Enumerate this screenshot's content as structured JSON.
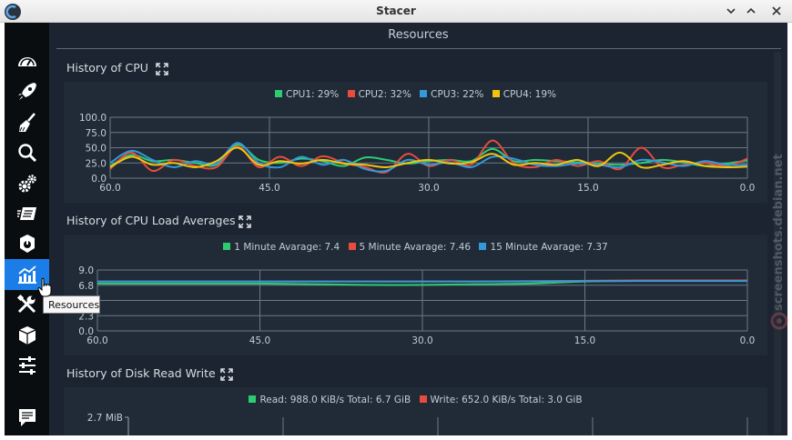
{
  "window": {
    "title": "Stacer"
  },
  "sidebar": {
    "items": [
      {
        "icon": "speedometer-icon",
        "name": "nav-dashboard"
      },
      {
        "icon": "rocket-icon",
        "name": "nav-startup-apps"
      },
      {
        "icon": "broom-icon",
        "name": "nav-system-cleaner"
      },
      {
        "icon": "search-icon",
        "name": "nav-search"
      },
      {
        "icon": "gears-icon",
        "name": "nav-services"
      },
      {
        "icon": "processes-icon",
        "name": "nav-processes"
      },
      {
        "icon": "uninstaller-icon",
        "name": "nav-uninstaller"
      },
      {
        "icon": "chart-icon",
        "name": "nav-resources",
        "active": true
      },
      {
        "icon": "tools-icon",
        "name": "nav-helpers"
      },
      {
        "icon": "package-icon",
        "name": "nav-apt-repository"
      },
      {
        "icon": "sliders-icon",
        "name": "nav-settings"
      },
      {
        "icon": "feedback-icon",
        "name": "nav-feedback"
      }
    ],
    "tooltip": "Resources"
  },
  "page": {
    "title": "Resources"
  },
  "watermark": "screenshots.debian.net",
  "colors": {
    "green": "#2ecc71",
    "red": "#e74c3c",
    "blue": "#3498db",
    "yellow": "#f1c40f",
    "accent": "#1b7ee8"
  },
  "sections": {
    "cpu": {
      "title": "History of CPU",
      "legend": [
        "CPU1: 29%",
        "CPU2: 32%",
        "CPU3: 22%",
        "CPU4: 19%"
      ]
    },
    "load": {
      "title": "History of CPU Load Averages",
      "legend": [
        "1 Minute Avarage: 7.4",
        "5 Minute Avarage: 7.46",
        "15 Minute Avarage: 7.37"
      ]
    },
    "disk": {
      "title": "History of Disk Read Write",
      "legend": [
        "Read: 988.0 KiB/s Total: 6.7 GiB",
        "Write: 652.0 KiB/s Total: 3.0 GiB"
      ]
    }
  },
  "chart_data": [
    {
      "type": "line",
      "title": "History of CPU",
      "x": [
        60,
        58,
        56,
        54,
        52,
        50,
        48,
        46,
        44,
        42,
        40,
        38,
        36,
        34,
        32,
        30,
        28,
        26,
        24,
        22,
        20,
        18,
        16,
        14,
        12,
        10,
        8,
        6,
        4,
        2,
        0
      ],
      "xticks": [
        "60.0",
        "45.0",
        "30.0",
        "15.0",
        "0.0"
      ],
      "yticks": [
        "0.0",
        "25.0",
        "50.0",
        "75.0",
        "100.0"
      ],
      "ylim": [
        0,
        100
      ],
      "xlim": [
        60,
        0
      ],
      "series": [
        {
          "name": "CPU1: 29%",
          "color": "#2ecc71",
          "values": [
            20,
            38,
            28,
            30,
            25,
            22,
            55,
            30,
            25,
            32,
            28,
            20,
            34,
            30,
            24,
            28,
            30,
            28,
            48,
            28,
            30,
            28,
            26,
            24,
            22,
            25,
            30,
            26,
            20,
            24,
            29
          ]
        },
        {
          "name": "CPU2: 32%",
          "color": "#e74c3c",
          "values": [
            15,
            42,
            12,
            30,
            20,
            18,
            52,
            18,
            35,
            20,
            36,
            25,
            18,
            10,
            40,
            20,
            30,
            22,
            62,
            25,
            18,
            30,
            20,
            28,
            15,
            50,
            18,
            22,
            25,
            20,
            32
          ]
        },
        {
          "name": "CPU3: 22%",
          "color": "#3498db",
          "values": [
            25,
            45,
            30,
            18,
            28,
            24,
            58,
            25,
            18,
            35,
            22,
            30,
            15,
            12,
            30,
            22,
            26,
            18,
            35,
            32,
            22,
            20,
            24,
            22,
            18,
            30,
            26,
            20,
            28,
            22,
            22
          ]
        },
        {
          "name": "CPU4: 19%",
          "color": "#f1c40f",
          "values": [
            18,
            35,
            22,
            25,
            18,
            28,
            50,
            22,
            28,
            24,
            30,
            24,
            22,
            18,
            25,
            30,
            24,
            26,
            40,
            22,
            25,
            22,
            30,
            20,
            42,
            18,
            22,
            28,
            20,
            18,
            19
          ]
        }
      ]
    },
    {
      "type": "line",
      "title": "History of CPU Load Averages",
      "x": [
        60,
        55,
        50,
        45,
        40,
        35,
        30,
        25,
        20,
        15,
        10,
        5,
        0
      ],
      "xticks": [
        "60.0",
        "45.0",
        "30.0",
        "15.0",
        "0.0"
      ],
      "yticks": [
        "0.0",
        "2.3",
        "4.5",
        "6.8",
        "9.0"
      ],
      "ylim": [
        0,
        9
      ],
      "xlim": [
        60,
        0
      ],
      "series": [
        {
          "name": "1 Minute Avarage: 7.4",
          "color": "#2ecc71",
          "values": [
            7.0,
            7.0,
            7.0,
            7.0,
            6.9,
            6.8,
            6.8,
            6.9,
            7.0,
            7.3,
            7.4,
            7.4,
            7.4
          ]
        },
        {
          "name": "5 Minute Avarage: 7.46",
          "color": "#e74c3c",
          "values": [
            7.3,
            7.3,
            7.3,
            7.3,
            7.3,
            7.3,
            7.3,
            7.3,
            7.35,
            7.4,
            7.45,
            7.46,
            7.46
          ]
        },
        {
          "name": "15 Minute Avarage: 7.37",
          "color": "#3498db",
          "values": [
            7.3,
            7.3,
            7.3,
            7.3,
            7.3,
            7.3,
            7.3,
            7.3,
            7.32,
            7.35,
            7.37,
            7.37,
            7.37
          ]
        }
      ]
    },
    {
      "type": "line",
      "title": "History of Disk Read Write",
      "yticks": [
        "2.7 MiB"
      ],
      "series": [
        {
          "name": "Read: 988.0 KiB/s Total: 6.7 GiB",
          "color": "#2ecc71",
          "values": []
        },
        {
          "name": "Write: 652.0 KiB/s Total: 3.0 GiB",
          "color": "#e74c3c",
          "values": []
        }
      ]
    }
  ]
}
